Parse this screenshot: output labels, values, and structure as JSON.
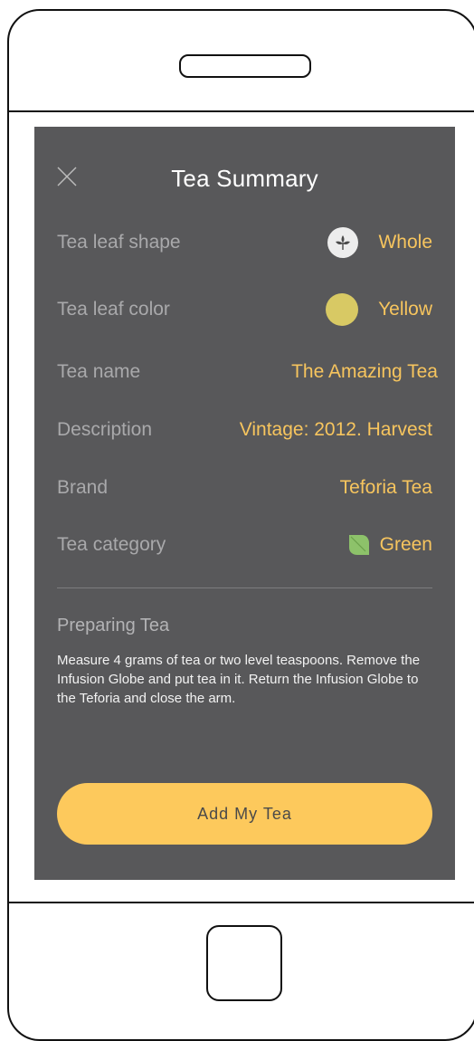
{
  "header": {
    "title": "Tea Summary"
  },
  "rows": [
    {
      "label": "Tea leaf shape",
      "value": "Whole",
      "icon": "whole-leaf-icon"
    },
    {
      "label": "Tea leaf color",
      "value": "Yellow",
      "icon": "color-dot",
      "color": "#d8c964"
    },
    {
      "label": "Tea name",
      "value": "The Amazing Tea"
    },
    {
      "label": "Description",
      "value": "Vintage: 2012. Harvest"
    },
    {
      "label": "Brand",
      "value": "Teforia Tea"
    },
    {
      "label": "Tea category",
      "value": "Green",
      "icon": "leaf-icon",
      "color": "#8dc26a"
    }
  ],
  "preparing": {
    "title": "Preparing Tea",
    "text": "Measure 4 grams of tea or two level teaspoons. Remove the Infusion Globe and put tea in it. Return the Infusion Globe to the Teforia and close the arm."
  },
  "actions": {
    "add_label": "Add My Tea"
  },
  "colors": {
    "background": "#58585a",
    "accent": "#f7c55e",
    "button": "#fdc95c"
  }
}
